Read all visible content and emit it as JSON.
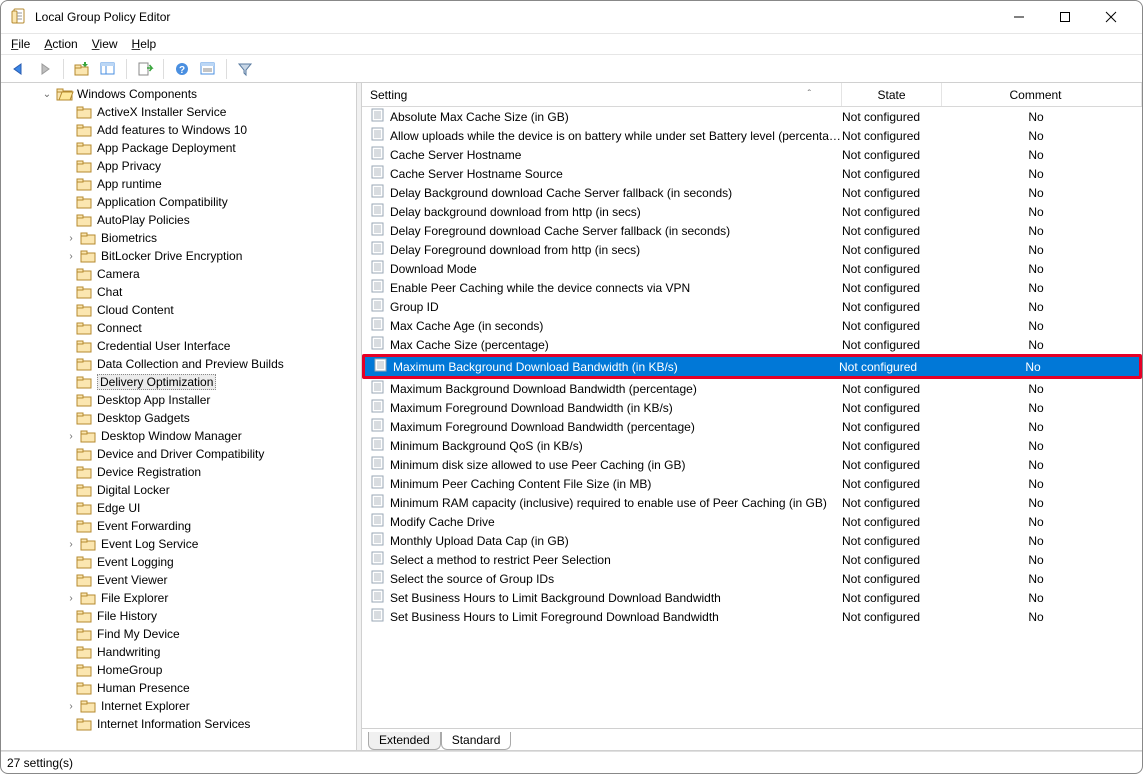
{
  "window": {
    "title": "Local Group Policy Editor"
  },
  "menu": {
    "file": "File",
    "action": "Action",
    "view": "View",
    "help": "Help"
  },
  "tree": {
    "root": "Windows Components",
    "selected": "Delivery Optimization",
    "items": [
      {
        "label": "ActiveX Installer Service",
        "exp": false
      },
      {
        "label": "Add features to Windows 10",
        "exp": false
      },
      {
        "label": "App Package Deployment",
        "exp": false
      },
      {
        "label": "App Privacy",
        "exp": false
      },
      {
        "label": "App runtime",
        "exp": false
      },
      {
        "label": "Application Compatibility",
        "exp": false
      },
      {
        "label": "AutoPlay Policies",
        "exp": false
      },
      {
        "label": "Biometrics",
        "exp": true
      },
      {
        "label": "BitLocker Drive Encryption",
        "exp": true
      },
      {
        "label": "Camera",
        "exp": false
      },
      {
        "label": "Chat",
        "exp": false
      },
      {
        "label": "Cloud Content",
        "exp": false
      },
      {
        "label": "Connect",
        "exp": false
      },
      {
        "label": "Credential User Interface",
        "exp": false
      },
      {
        "label": "Data Collection and Preview Builds",
        "exp": false
      },
      {
        "label": "Delivery Optimization",
        "exp": false,
        "selected": true
      },
      {
        "label": "Desktop App Installer",
        "exp": false
      },
      {
        "label": "Desktop Gadgets",
        "exp": false
      },
      {
        "label": "Desktop Window Manager",
        "exp": true
      },
      {
        "label": "Device and Driver Compatibility",
        "exp": false
      },
      {
        "label": "Device Registration",
        "exp": false
      },
      {
        "label": "Digital Locker",
        "exp": false
      },
      {
        "label": "Edge UI",
        "exp": false
      },
      {
        "label": "Event Forwarding",
        "exp": false
      },
      {
        "label": "Event Log Service",
        "exp": true
      },
      {
        "label": "Event Logging",
        "exp": false
      },
      {
        "label": "Event Viewer",
        "exp": false
      },
      {
        "label": "File Explorer",
        "exp": true
      },
      {
        "label": "File History",
        "exp": false
      },
      {
        "label": "Find My Device",
        "exp": false
      },
      {
        "label": "Handwriting",
        "exp": false
      },
      {
        "label": "HomeGroup",
        "exp": false
      },
      {
        "label": "Human Presence",
        "exp": false
      },
      {
        "label": "Internet Explorer",
        "exp": true
      },
      {
        "label": "Internet Information Services",
        "exp": false
      }
    ]
  },
  "columns": {
    "setting": "Setting",
    "state": "State",
    "comment": "Comment"
  },
  "settings": [
    {
      "name": "Absolute Max Cache Size (in GB)",
      "state": "Not configured",
      "comment": "No"
    },
    {
      "name": "Allow uploads while the device is on battery while under set Battery level (percentage)",
      "state": "Not configured",
      "comment": "No"
    },
    {
      "name": "Cache Server Hostname",
      "state": "Not configured",
      "comment": "No"
    },
    {
      "name": "Cache Server Hostname Source",
      "state": "Not configured",
      "comment": "No"
    },
    {
      "name": "Delay Background download Cache Server fallback (in seconds)",
      "state": "Not configured",
      "comment": "No"
    },
    {
      "name": "Delay background download from http (in secs)",
      "state": "Not configured",
      "comment": "No"
    },
    {
      "name": "Delay Foreground download Cache Server fallback (in seconds)",
      "state": "Not configured",
      "comment": "No"
    },
    {
      "name": "Delay Foreground download from http (in secs)",
      "state": "Not configured",
      "comment": "No"
    },
    {
      "name": "Download Mode",
      "state": "Not configured",
      "comment": "No"
    },
    {
      "name": "Enable Peer Caching while the device connects via VPN",
      "state": "Not configured",
      "comment": "No"
    },
    {
      "name": "Group ID",
      "state": "Not configured",
      "comment": "No"
    },
    {
      "name": "Max Cache Age (in seconds)",
      "state": "Not configured",
      "comment": "No"
    },
    {
      "name": "Max Cache Size (percentage)",
      "state": "Not configured",
      "comment": "No"
    },
    {
      "name": "Maximum Background Download Bandwidth (in KB/s)",
      "state": "Not configured",
      "comment": "No",
      "selected": true,
      "highlighted": true
    },
    {
      "name": "Maximum Background Download Bandwidth (percentage)",
      "state": "Not configured",
      "comment": "No"
    },
    {
      "name": "Maximum Foreground Download Bandwidth (in KB/s)",
      "state": "Not configured",
      "comment": "No"
    },
    {
      "name": "Maximum Foreground Download Bandwidth (percentage)",
      "state": "Not configured",
      "comment": "No"
    },
    {
      "name": "Minimum Background QoS (in KB/s)",
      "state": "Not configured",
      "comment": "No"
    },
    {
      "name": "Minimum disk size allowed to use Peer Caching (in GB)",
      "state": "Not configured",
      "comment": "No"
    },
    {
      "name": "Minimum Peer Caching Content File Size (in MB)",
      "state": "Not configured",
      "comment": "No"
    },
    {
      "name": "Minimum RAM capacity (inclusive) required to enable use of Peer Caching (in GB)",
      "state": "Not configured",
      "comment": "No"
    },
    {
      "name": "Modify Cache Drive",
      "state": "Not configured",
      "comment": "No"
    },
    {
      "name": "Monthly Upload Data Cap (in GB)",
      "state": "Not configured",
      "comment": "No"
    },
    {
      "name": "Select a method to restrict Peer Selection",
      "state": "Not configured",
      "comment": "No"
    },
    {
      "name": "Select the source of Group IDs",
      "state": "Not configured",
      "comment": "No"
    },
    {
      "name": "Set Business Hours to Limit Background Download Bandwidth",
      "state": "Not configured",
      "comment": "No"
    },
    {
      "name": "Set Business Hours to Limit Foreground Download Bandwidth",
      "state": "Not configured",
      "comment": "No"
    }
  ],
  "tabs": {
    "extended": "Extended",
    "standard": "Standard"
  },
  "status": "27 setting(s)"
}
